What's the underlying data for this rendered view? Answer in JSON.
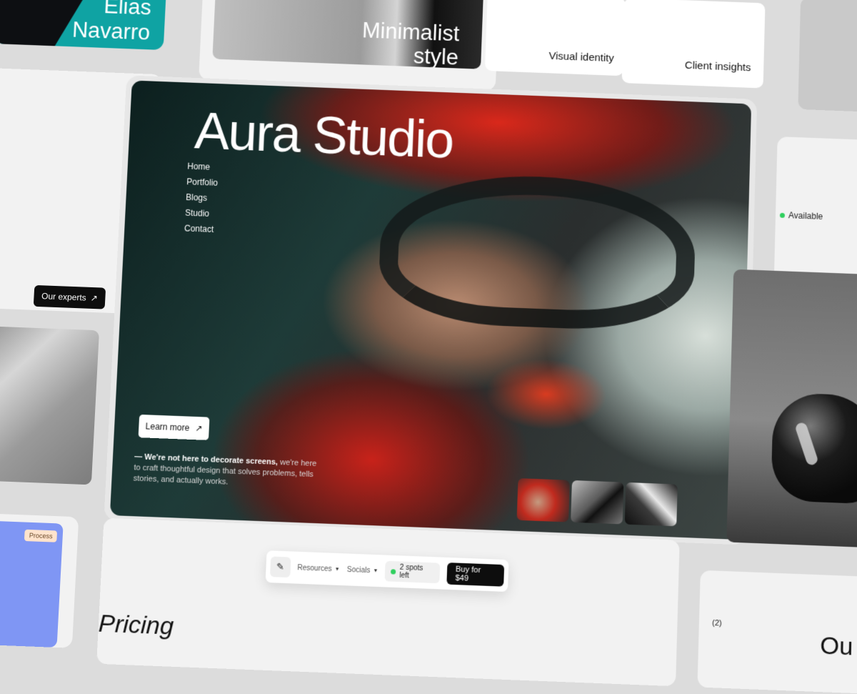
{
  "name_card": {
    "line1": "Elias",
    "line2": "Navarro"
  },
  "minimal_card": {
    "line1": "Minimalist",
    "line2": "style"
  },
  "tiles": {
    "visual_identity": "Visual identity",
    "client_insights": "Client insights"
  },
  "left": {
    "experts_label": "Our experts",
    "experts_arrow": "↗"
  },
  "process_tag": "Process",
  "hero": {
    "title": "Aura Studio",
    "nav": [
      "Home",
      "Portfolio",
      "Blogs",
      "Studio",
      "Contact"
    ],
    "learn_more": "Learn more",
    "learn_arrow": "↗",
    "tagline_bold": "— We're not here to decorate screens,",
    "tagline_rest": " we're here to craft thoughtful design that solves problems, tells stories, and actually works."
  },
  "right": {
    "available": "Available",
    "status_color": "#2fcf5e"
  },
  "toolbar": {
    "icon": "pen-icon",
    "resources": "Resources",
    "socials": "Socials",
    "spots": "2 spots left",
    "buy": "Buy for $49"
  },
  "bottom": {
    "pricing": "Pricing",
    "count": "(2)",
    "partial_heading": "Ou"
  }
}
